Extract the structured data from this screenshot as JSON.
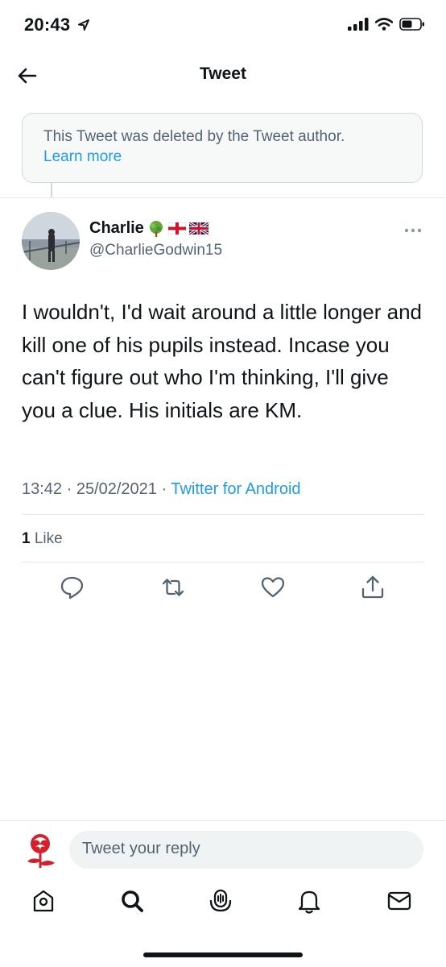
{
  "status_bar": {
    "time": "20:43"
  },
  "header": {
    "title": "Tweet"
  },
  "deleted_notice": {
    "text": "This Tweet was deleted by the Tweet author.",
    "link": "Learn more"
  },
  "tweet": {
    "author_name": "Charlie",
    "author_handle": "@CharlieGodwin15",
    "text": "I wouldn't, I'd wait around a little longer and kill one of his pupils instead. Incase you can't figure out who I'm thinking, I'll give you a clue. His initials are KM.",
    "timestamp": "13:42 · 25/02/2021 · ",
    "source": "Twitter for Android",
    "like_count": "1",
    "like_label": "Like"
  },
  "reply_bar": {
    "placeholder": "Tweet your reply"
  },
  "colors": {
    "accent": "#1d9bf0",
    "muted": "#536471",
    "text": "#0f1419",
    "border": "#cfd9de"
  },
  "icons": {
    "header": [
      "back-arrow-icon"
    ],
    "actions": [
      "reply-icon",
      "retweet-icon",
      "like-icon",
      "share-icon"
    ],
    "nav": [
      "home-icon",
      "search-icon",
      "spaces-icon",
      "notifications-icon",
      "messages-icon"
    ]
  }
}
